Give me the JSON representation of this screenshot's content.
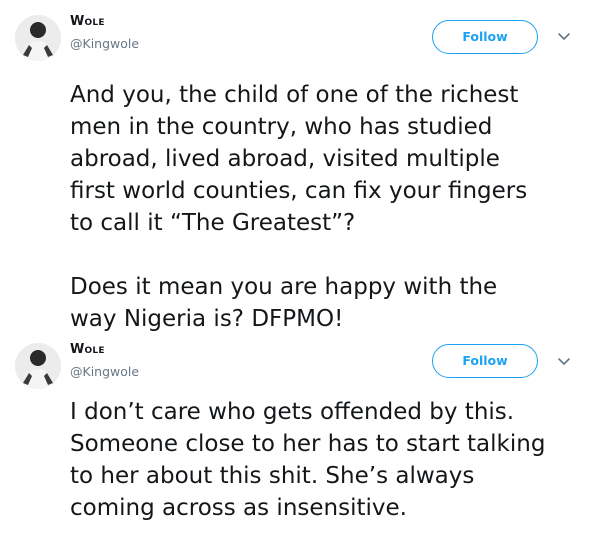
{
  "tweets": [
    {
      "author_name": "Wole",
      "handle": "@Kingwole",
      "follow_label": "Follow",
      "paragraphs": [
        "And you, the child of one of the richest\nmen in the country, who has studied\nabroad, lived abroad, visited multiple\nfirst world counties, can fix your fingers\nto call it “The Greatest”?",
        "Does it mean you are happy with the\nway Nigeria is? DFPMO!"
      ]
    },
    {
      "author_name": "Wole",
      "handle": "@Kingwole",
      "follow_label": "Follow",
      "paragraphs": [
        "I don’t care who gets offended by this.\nSomeone close to her has to start talking\nto her about this shit. She’s always\ncoming across as insensitive."
      ]
    }
  ],
  "colors": {
    "accent": "#1da1f2",
    "text_primary": "#14171a",
    "text_secondary": "#657786"
  },
  "icons": {
    "menu": "chevron-down-icon",
    "avatar": "profile-photo"
  }
}
